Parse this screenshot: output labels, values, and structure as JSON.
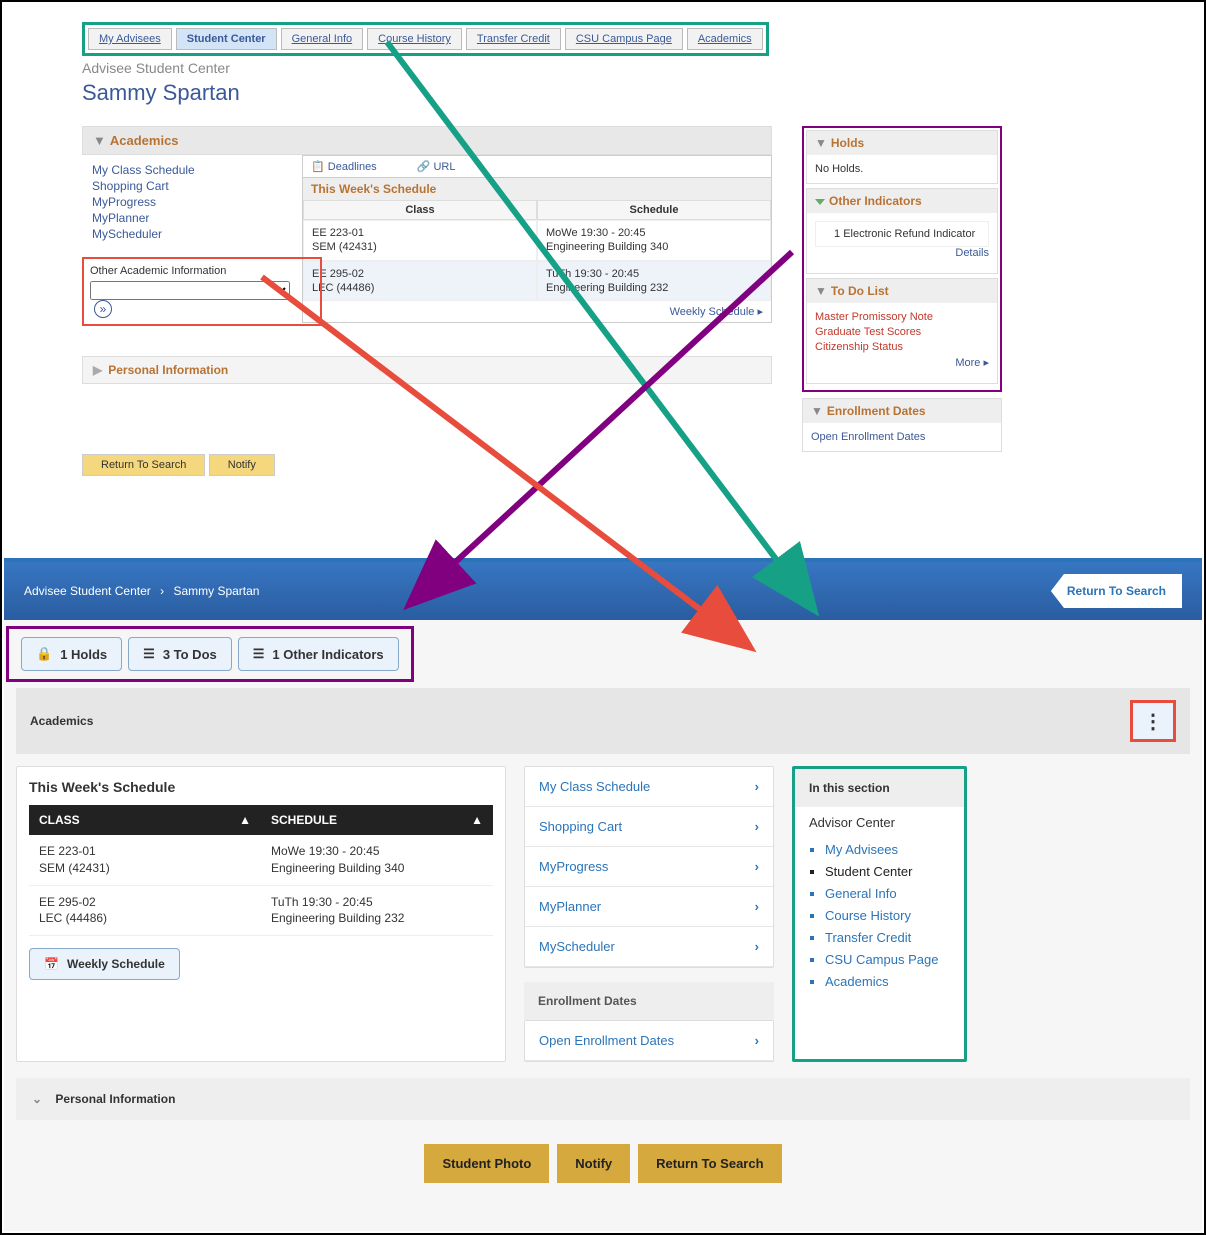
{
  "tabs": [
    "My Advisees",
    "Student Center",
    "General Info",
    "Course History",
    "Transfer Credit",
    "CSU Campus Page",
    "Academics"
  ],
  "active_tab": 1,
  "page_title": "Advisee Student Center",
  "student_name": "Sammy Spartan",
  "academics": {
    "heading": "Academics",
    "links": [
      "My Class Schedule",
      "Shopping Cart",
      "MyProgress",
      "MyPlanner",
      "MyScheduler"
    ],
    "other_label": "Other Academic Information",
    "deadlines": "Deadlines",
    "url": "URL",
    "this_week": "This Week's Schedule",
    "cols": [
      "Class",
      "Schedule"
    ],
    "rows": [
      {
        "class": "EE 223-01\nSEM (42431)",
        "schedule": "MoWe 19:30 - 20:45\nEngineering Building 340"
      },
      {
        "class": "EE 295-02\nLEC (44486)",
        "schedule": "TuTh 19:30 - 20:45\nEngineering Building 232"
      }
    ],
    "weekly_link": "Weekly Schedule ▸"
  },
  "personal_info": "Personal Information",
  "buttons": {
    "return": "Return To Search",
    "notify": "Notify"
  },
  "side": {
    "holds": {
      "heading": "Holds",
      "body": "No Holds."
    },
    "other": {
      "heading": "Other Indicators",
      "item_num": "1",
      "item": "Electronic Refund Indicator",
      "details": "Details"
    },
    "todo": {
      "heading": "To Do List",
      "items": [
        "Master Promissory Note",
        "Graduate Test Scores",
        "Citizenship Status"
      ],
      "more": "More ▸"
    },
    "enroll": {
      "heading": "Enrollment Dates",
      "link": "Open Enrollment Dates"
    }
  },
  "lower": {
    "breadcrumb": [
      "Advisee Student Center",
      "Sammy Spartan"
    ],
    "return": "Return To Search",
    "pills": [
      {
        "icon": "🔒",
        "text": "1 Holds"
      },
      {
        "icon": "☰",
        "text": "3 To Dos"
      },
      {
        "icon": "☰",
        "text": "1 Other Indicators"
      }
    ],
    "section_title": "Academics",
    "this_week": "This Week's Schedule",
    "cols": [
      "CLASS",
      "SCHEDULE"
    ],
    "rows": [
      {
        "class": "EE 223-01\nSEM (42431)",
        "schedule": "MoWe 19:30 - 20:45\nEngineering Building 340"
      },
      {
        "class": "EE 295-02\nLEC (44486)",
        "schedule": "TuTh 19:30 - 20:45\nEngineering Building 232"
      }
    ],
    "weekly_btn": "Weekly Schedule",
    "mid_links": [
      "My Class Schedule",
      "Shopping Cart",
      "MyProgress",
      "MyPlanner",
      "MyScheduler"
    ],
    "enroll_label": "Enrollment Dates",
    "enroll_link": "Open Enrollment Dates",
    "right": {
      "heading": "In this section",
      "sub": "Advisor Center",
      "items": [
        "My Advisees",
        "Student Center",
        "General Info",
        "Course History",
        "Transfer Credit",
        "CSU Campus Page",
        "Academics"
      ],
      "black_index": 1
    },
    "personal": "Personal Information",
    "bottom_buttons": [
      "Student Photo",
      "Notify",
      "Return To Search"
    ]
  }
}
